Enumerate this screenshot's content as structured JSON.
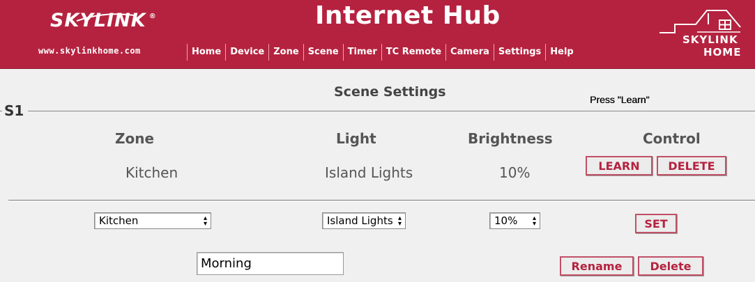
{
  "header": {
    "brand": "SKYLINK",
    "brand_mark": "®",
    "website": "www.skylinkhome.com",
    "title": "Internet Hub",
    "nav": [
      "Home",
      "Device",
      "Zone",
      "Scene",
      "Timer",
      "TC Remote",
      "Camera",
      "Settings",
      "Help"
    ],
    "home_logo_line1": "SKYLINK",
    "home_logo_line2": "HOME"
  },
  "page": {
    "title": "Scene Settings",
    "status_message": "Press \"Learn\"",
    "scene_label": "S1"
  },
  "table": {
    "headers": [
      "Zone",
      "Light",
      "Brightness",
      "Control"
    ],
    "row": {
      "zone": "Kitchen",
      "light": "Island Lights",
      "brightness": "10%"
    },
    "learn_label": "LEARN",
    "delete_label": "DELETE"
  },
  "form": {
    "zone_select": "Kitchen",
    "light_select": "Island Lights",
    "brightness_select": "10%",
    "set_label": "SET",
    "scene_name": "Morning",
    "rename_label": "Rename",
    "delete_label": "Delete"
  },
  "colors": {
    "header_bg": "#b5223f",
    "accent": "#b5223f",
    "page_bg": "#f0f0f0"
  },
  "icons": {
    "select_arrow": "dropdown-arrow-icon",
    "home_logo": "house-outline-icon"
  }
}
